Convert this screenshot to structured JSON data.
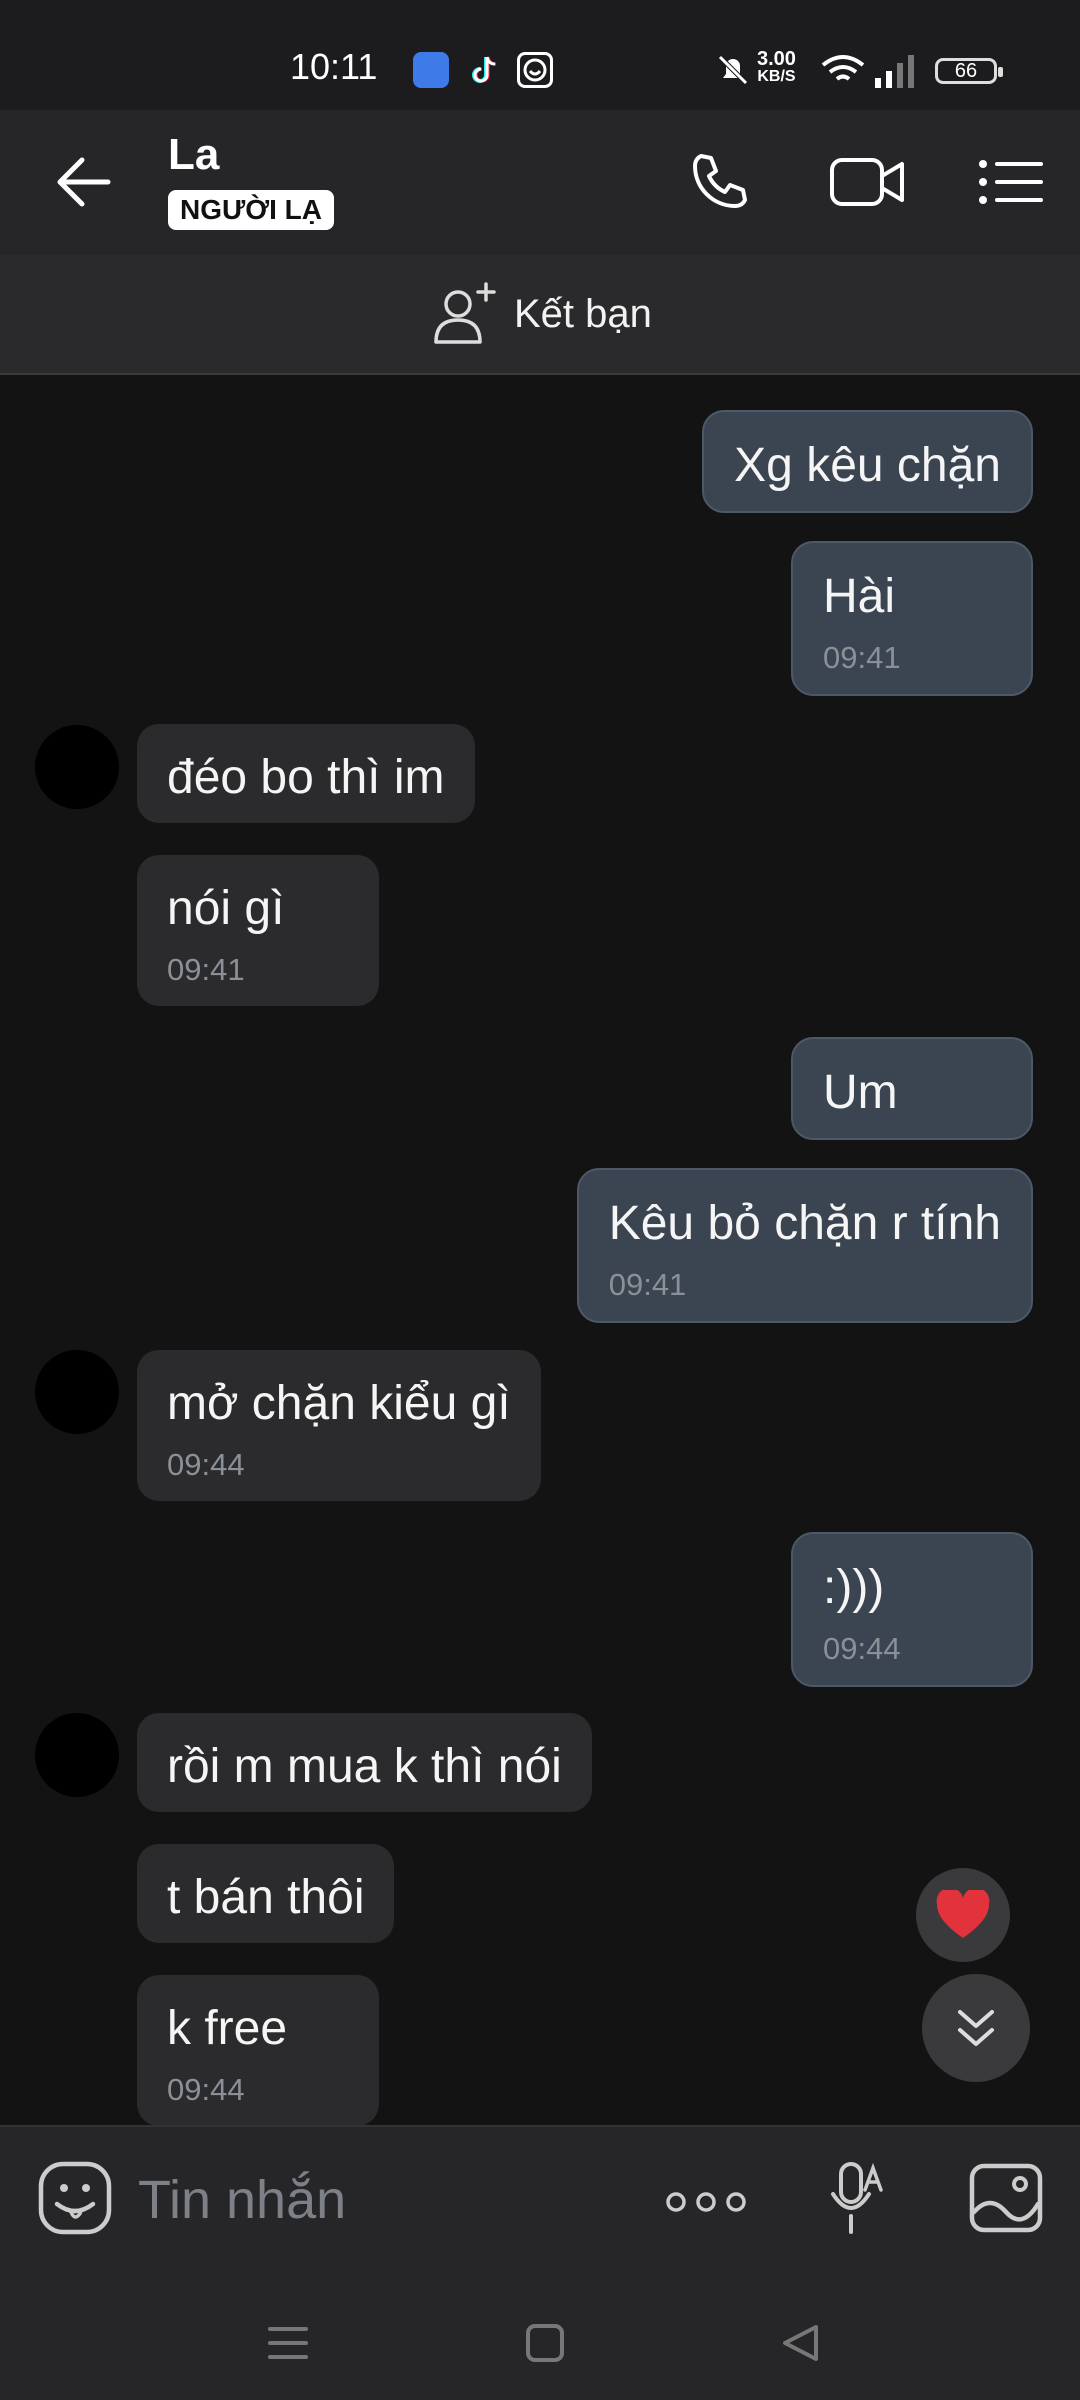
{
  "status_bar": {
    "time": "10:11",
    "net_speed_value": "3.00",
    "net_speed_unit": "KB/S",
    "battery": "66"
  },
  "header": {
    "contact_name": "La",
    "badge": "NGƯỜI LẠ"
  },
  "add_friend": {
    "label": "Kết bạn"
  },
  "messages": [
    {
      "side": "out",
      "text": "Xg kêu chặn",
      "time": ""
    },
    {
      "side": "out",
      "text": "Hài",
      "time": "09:41"
    },
    {
      "side": "in",
      "text": "đéo bo thì im",
      "time": ""
    },
    {
      "side": "in",
      "text": "nói gì",
      "time": "09:41"
    },
    {
      "side": "out",
      "text": "Um",
      "time": ""
    },
    {
      "side": "out",
      "text": "Kêu bỏ chặn r tính",
      "time": "09:41"
    },
    {
      "side": "in",
      "text": "mở chặn kiểu gì",
      "time": "09:44"
    },
    {
      "side": "out",
      "text": ":)))",
      "time": "09:44"
    },
    {
      "side": "in",
      "text": "rồi m mua k thì nói",
      "time": ""
    },
    {
      "side": "in",
      "text": "t bán thôi",
      "time": ""
    },
    {
      "side": "in",
      "text": "k free",
      "time": "09:44"
    }
  ],
  "composer": {
    "placeholder": "Tin nhắn"
  },
  "icons": {
    "back": "back-arrow-icon",
    "call": "phone-icon",
    "video": "video-camera-icon",
    "menu": "list-menu-icon",
    "add_friend": "add-user-icon",
    "sticker": "sticker-icon",
    "more": "more-dots-icon",
    "voice": "voice-to-text-icon",
    "gallery": "image-icon",
    "heart": "heart-icon",
    "scroll_down": "double-chevron-down-icon"
  },
  "colors": {
    "background": "#131314",
    "outgoing_bubble": "#3b4451",
    "incoming_bubble": "#2b2b2d",
    "header": "#262628",
    "heart": "#e2323b"
  }
}
